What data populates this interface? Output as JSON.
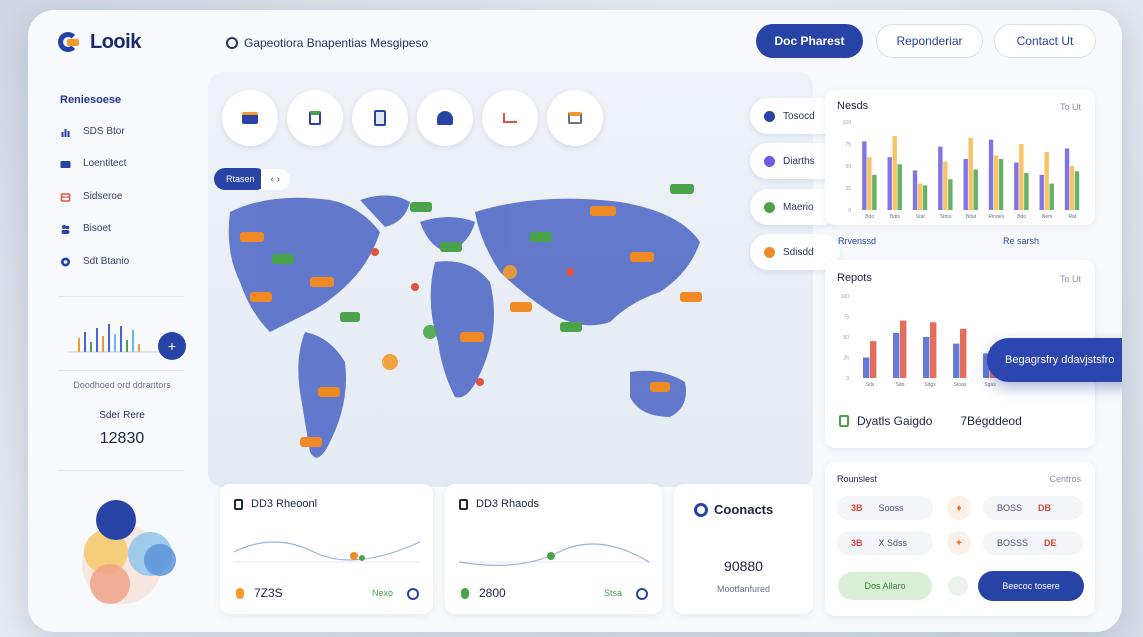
{
  "header": {
    "logo_text": "Looik",
    "tagline": "Gapeotiora Bnapentias Mesgipeso",
    "btn_primary": "Doc Pharest",
    "btn_secondary": "Reponderiar",
    "btn_contact": "Contact Ut"
  },
  "sidebar": {
    "title": "Reniesoese",
    "items": [
      {
        "label": "SDS Btor",
        "icon": "chart-icon"
      },
      {
        "label": "Loentitect",
        "icon": "folder-icon"
      },
      {
        "label": "Sidseroe",
        "icon": "shop-icon"
      },
      {
        "label": "Bisoet",
        "icon": "users-icon"
      },
      {
        "label": "Sdt Btanio",
        "icon": "globe-icon"
      }
    ],
    "caption": "Doodhoed ord ddrantors",
    "stat_label": "Sder Rere",
    "stat_value": "12830"
  },
  "map": {
    "tab_active": "Rtasen",
    "tab_ctrl": "‹ ›",
    "legend": [
      {
        "label": "Tosocd",
        "color": "#2743a6"
      },
      {
        "label": "Diarths",
        "color": "#6b5ce0"
      },
      {
        "label": "Maerio",
        "color": "#4aa34a"
      },
      {
        "label": "Sdisdd",
        "color": "#f08a24"
      }
    ]
  },
  "cards": {
    "chart1": {
      "title": "Nesds",
      "meta": "To  Ut",
      "link_left": "Rrvenssd",
      "link_right": "Re sarsh"
    },
    "chart2": {
      "title": "Repots",
      "meta": "To  Ut",
      "footer_tag": "Dyatls Gaigdo",
      "footer_value": "7Bégddeod"
    },
    "card_a": {
      "title": "DD3 Rheoonl",
      "value": "7Z3S",
      "tag": "Nexo"
    },
    "card_b": {
      "title": "DD3 Rhaods",
      "value": "2800",
      "tag": "Stsa"
    },
    "contacts": {
      "title": "Coonacts",
      "value": "90880",
      "sub": "Mootfanfured"
    },
    "bookings": {
      "title": "Rounslest",
      "meta": "Centros",
      "rows": [
        {
          "num": "3B",
          "label": "Sooss"
        },
        {
          "num": "3B",
          "label": "X Sdss"
        }
      ],
      "rows_right": [
        {
          "label": "BOSS",
          "num": "DB"
        },
        {
          "label": "BOSSS",
          "num": "DE"
        }
      ],
      "green_btn": "Dos Allaro",
      "blue_btn": "Beecoc tosere"
    },
    "floating_pill": "Begagrsfry ddavjstsfro"
  },
  "chart_data": [
    {
      "type": "bar",
      "title": "Nesds",
      "categories": [
        "Bdo",
        "Bdts",
        "Stat",
        "Stmo",
        "Bdat",
        "Rinden",
        "Bdo",
        "Nem",
        "Rat"
      ],
      "series": [
        {
          "values": [
            78,
            60,
            45,
            72,
            58,
            80,
            54,
            40,
            70
          ]
        },
        {
          "values": [
            60,
            84,
            30,
            55,
            82,
            62,
            75,
            66,
            50
          ]
        },
        {
          "values": [
            40,
            52,
            28,
            35,
            46,
            58,
            42,
            30,
            44
          ]
        }
      ],
      "ylim": [
        0,
        100
      ]
    },
    {
      "type": "bar",
      "title": "Repots",
      "categories": [
        "Sds",
        "Sdo",
        "Sdgs",
        "Stoas",
        "Sgas"
      ],
      "series": [
        {
          "values": [
            25,
            55,
            50,
            42,
            30
          ]
        },
        {
          "values": [
            45,
            70,
            68,
            60,
            38
          ]
        }
      ],
      "ylim": [
        0,
        100
      ]
    }
  ]
}
